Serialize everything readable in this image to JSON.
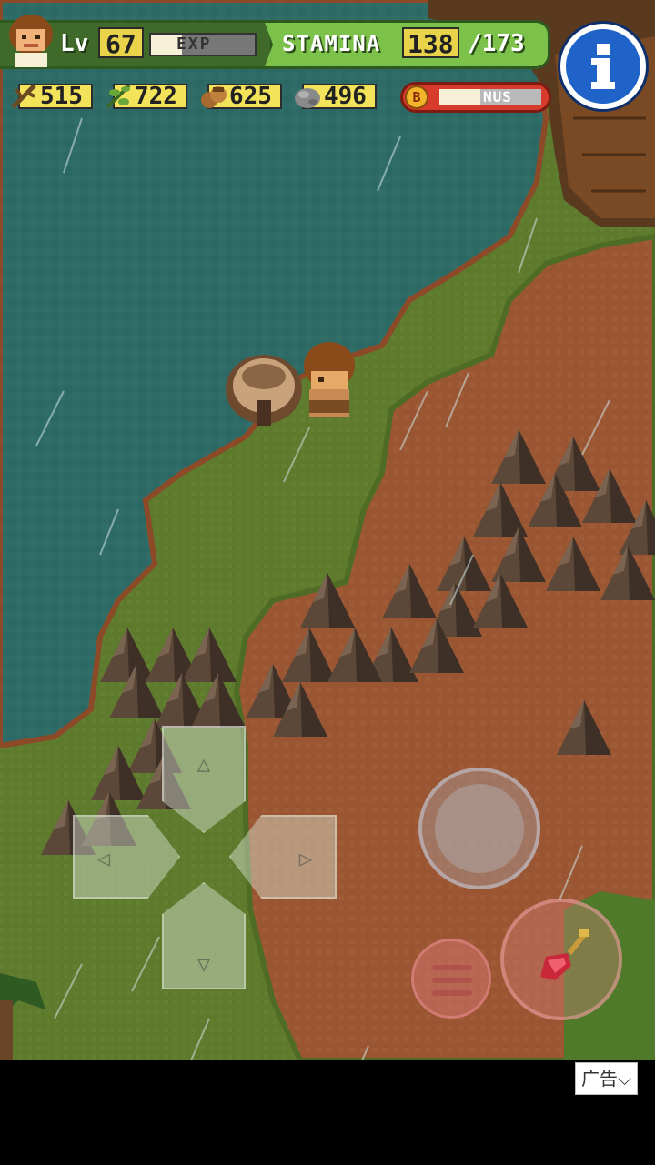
{
  "hud": {
    "level_label": "Lv",
    "level": "67",
    "exp_label": "EXP",
    "exp_fraction": 0.3,
    "stamina_label": "STAMINA",
    "stamina_current": "138",
    "stamina_max": "/173"
  },
  "resources": [
    {
      "name": "branches",
      "icon": "branch-icon",
      "value": "515"
    },
    {
      "name": "herbs",
      "icon": "herb-icon",
      "value": "722"
    },
    {
      "name": "nuts",
      "icon": "nut-icon",
      "value": "625"
    },
    {
      "name": "stones",
      "icon": "stone-icon",
      "value": "496"
    }
  ],
  "bonus": {
    "coin_letter": "B",
    "label": "NUS",
    "fraction": 0.4
  },
  "controls": {
    "dpad_up": "△",
    "dpad_down": "▽",
    "dpad_left": "◁",
    "dpad_right": "▷"
  },
  "ad": {
    "label": "广告⌵"
  },
  "colors": {
    "water": "#2e6b66",
    "grass": "#5d7a2d",
    "dirt": "#9a5632",
    "rock": "#5a4638",
    "hud_green": "#7cc24a",
    "info_blue": "#1f63c8"
  }
}
